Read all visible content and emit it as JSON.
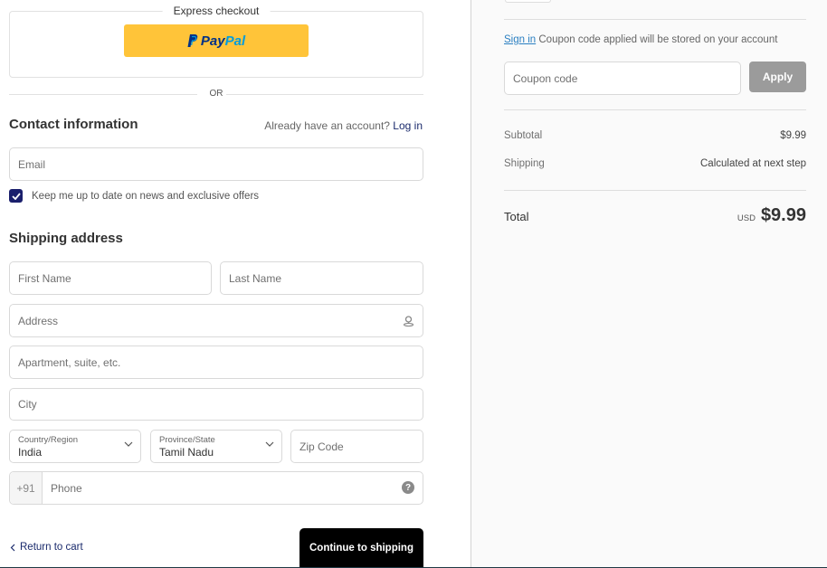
{
  "express_checkout": {
    "label": "Express checkout",
    "paypal": {
      "pay": "Pay",
      "pal": "Pal",
      "colors": {
        "button": "#ffc439",
        "dark": "#003087",
        "light": "#009cde"
      }
    },
    "or_label": "OR"
  },
  "contact": {
    "title": "Contact information",
    "account_prompt": "Already have an account?",
    "login_label": "Log in",
    "email_placeholder": "Email",
    "newsletter_label": "Keep me up to date on news and exclusive offers",
    "newsletter_checked": true
  },
  "shipping": {
    "title": "Shipping address",
    "first_name_placeholder": "First Name",
    "last_name_placeholder": "Last Name",
    "address_placeholder": "Address",
    "apartment_placeholder": "Apartment, suite, etc.",
    "city_placeholder": "City",
    "country": {
      "label": "Country/Region",
      "value": "India"
    },
    "province": {
      "label": "Province/State",
      "value": "Tamil Nadu"
    },
    "zip_placeholder": "Zip Code",
    "phone_prefix": "+91",
    "phone_placeholder": "Phone",
    "help_glyph": "?"
  },
  "footer": {
    "return_label": "Return to cart",
    "continue_label": "Continue to shipping"
  },
  "summary": {
    "signin_link": "Sign in",
    "signin_note": "Coupon code applied will be stored on your account",
    "coupon_placeholder": "Coupon code",
    "apply_label": "Apply",
    "subtotal_label": "Subtotal",
    "subtotal_value": "$9.99",
    "shipping_label": "Shipping",
    "shipping_value": "Calculated at next step",
    "total_label": "Total",
    "currency": "USD",
    "total_value": "$9.99"
  },
  "colors": {
    "accent": "#1a1f6c",
    "link": "#2a7fc1",
    "apply_button": "#9b9b9b",
    "primary_button": "#000000"
  }
}
